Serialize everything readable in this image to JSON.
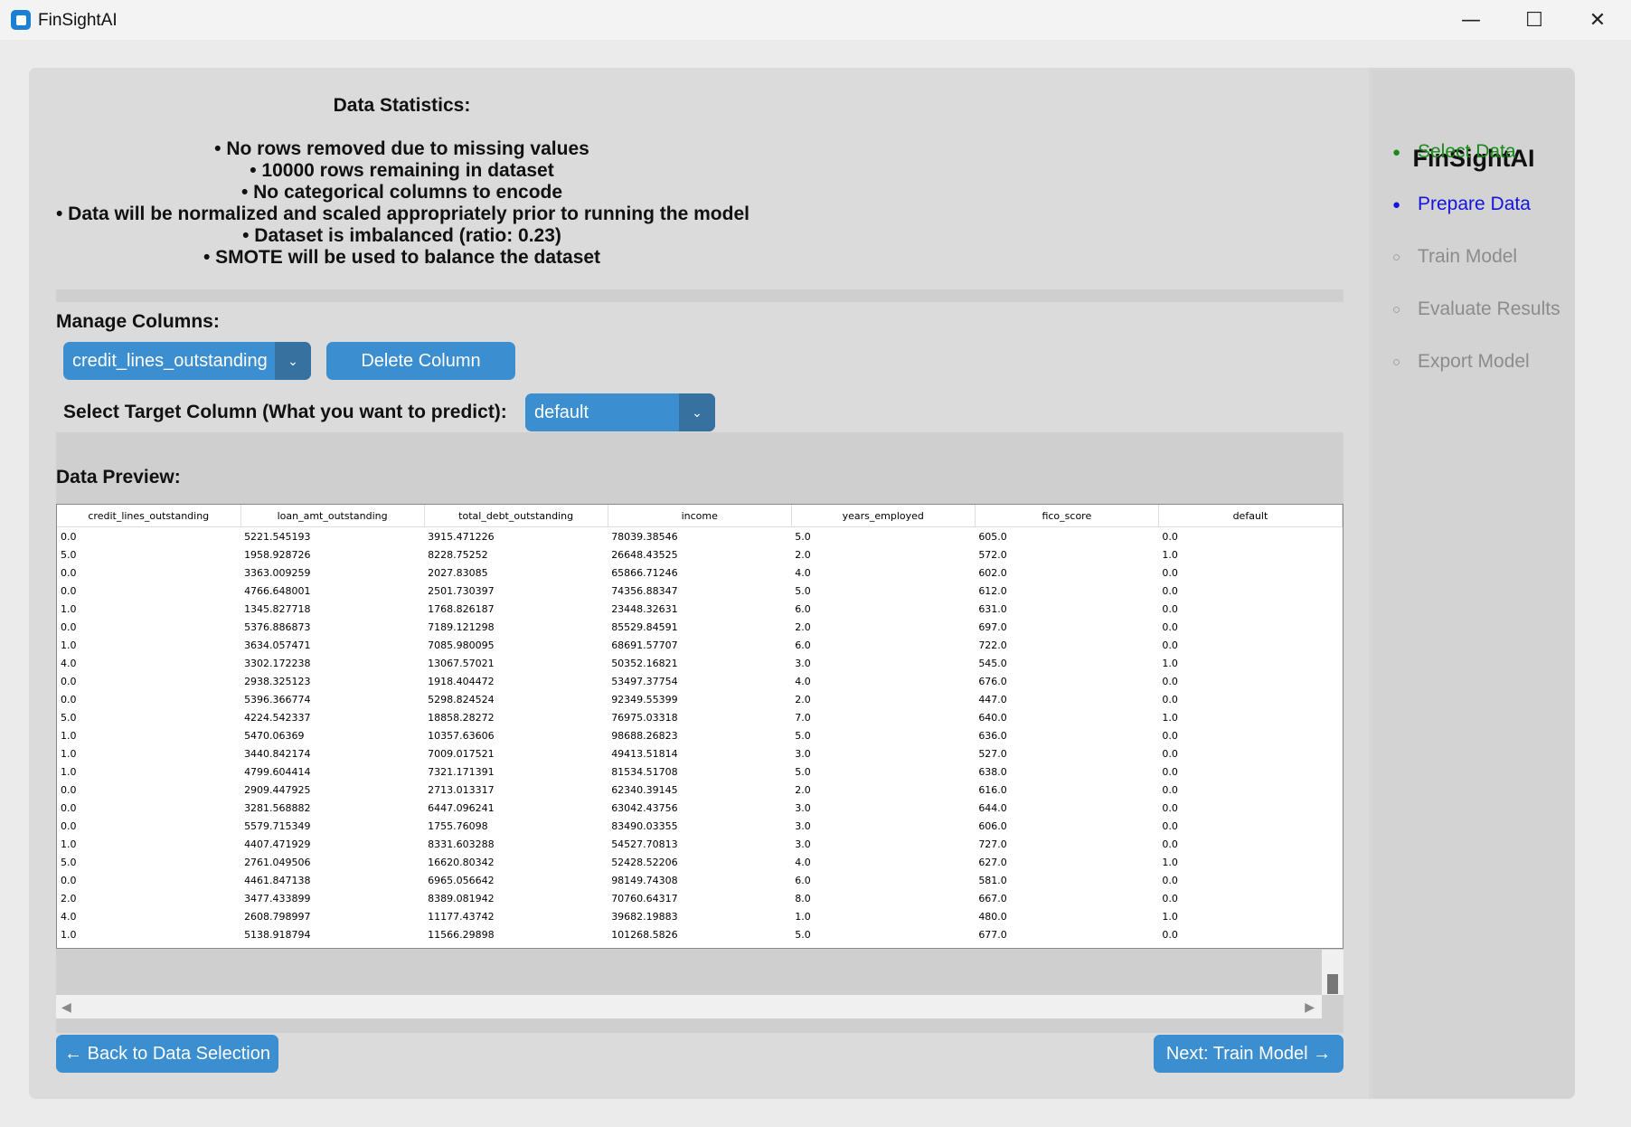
{
  "window": {
    "title": "FinSightAI",
    "minimize": "—",
    "maximize": "☐",
    "close": "✕"
  },
  "stats": {
    "title": "Data Statistics:",
    "lines": [
      "• No rows removed due to missing values",
      "• 10000 rows remaining in dataset",
      "• No categorical columns to encode",
      "• Data will be normalized and scaled appropriately prior to running the model",
      "• Dataset is imbalanced (ratio: 0.23)",
      "• SMOTE will be used to balance the dataset"
    ]
  },
  "manage": {
    "label": "Manage Columns:",
    "selected_column": "credit_lines_outstanding",
    "delete_label": "Delete Column"
  },
  "target": {
    "label": "Select Target Column (What you want to predict):",
    "value": "default"
  },
  "preview": {
    "label": "Data Preview:",
    "columns": [
      "credit_lines_outstanding",
      "loan_amt_outstanding",
      "total_debt_outstanding",
      "income",
      "years_employed",
      "fico_score",
      "default"
    ],
    "rows": [
      [
        "0.0",
        "5221.545193",
        "3915.471226",
        "78039.38546",
        "5.0",
        "605.0",
        "0.0"
      ],
      [
        "5.0",
        "1958.928726",
        "8228.75252",
        "26648.43525",
        "2.0",
        "572.0",
        "1.0"
      ],
      [
        "0.0",
        "3363.009259",
        "2027.83085",
        "65866.71246",
        "4.0",
        "602.0",
        "0.0"
      ],
      [
        "0.0",
        "4766.648001",
        "2501.730397",
        "74356.88347",
        "5.0",
        "612.0",
        "0.0"
      ],
      [
        "1.0",
        "1345.827718",
        "1768.826187",
        "23448.32631",
        "6.0",
        "631.0",
        "0.0"
      ],
      [
        "0.0",
        "5376.886873",
        "7189.121298",
        "85529.84591",
        "2.0",
        "697.0",
        "0.0"
      ],
      [
        "1.0",
        "3634.057471",
        "7085.980095",
        "68691.57707",
        "6.0",
        "722.0",
        "0.0"
      ],
      [
        "4.0",
        "3302.172238",
        "13067.57021",
        "50352.16821",
        "3.0",
        "545.0",
        "1.0"
      ],
      [
        "0.0",
        "2938.325123",
        "1918.404472",
        "53497.37754",
        "4.0",
        "676.0",
        "0.0"
      ],
      [
        "0.0",
        "5396.366774",
        "5298.824524",
        "92349.55399",
        "2.0",
        "447.0",
        "0.0"
      ],
      [
        "5.0",
        "4224.542337",
        "18858.28272",
        "76975.03318",
        "7.0",
        "640.0",
        "1.0"
      ],
      [
        "1.0",
        "5470.06369",
        "10357.63606",
        "98688.26823",
        "5.0",
        "636.0",
        "0.0"
      ],
      [
        "1.0",
        "3440.842174",
        "7009.017521",
        "49413.51814",
        "3.0",
        "527.0",
        "0.0"
      ],
      [
        "1.0",
        "4799.604414",
        "7321.171391",
        "81534.51708",
        "5.0",
        "638.0",
        "0.0"
      ],
      [
        "0.0",
        "2909.447925",
        "2713.013317",
        "62340.39145",
        "2.0",
        "616.0",
        "0.0"
      ],
      [
        "0.0",
        "3281.568882",
        "6447.096241",
        "63042.43756",
        "3.0",
        "644.0",
        "0.0"
      ],
      [
        "0.0",
        "5579.715349",
        "1755.76098",
        "83490.03355",
        "3.0",
        "606.0",
        "0.0"
      ],
      [
        "1.0",
        "4407.471929",
        "8331.603288",
        "54527.70813",
        "3.0",
        "727.0",
        "0.0"
      ],
      [
        "5.0",
        "2761.049506",
        "16620.80342",
        "52428.52206",
        "4.0",
        "627.0",
        "1.0"
      ],
      [
        "0.0",
        "4461.847138",
        "6965.056642",
        "98149.74308",
        "6.0",
        "581.0",
        "0.0"
      ],
      [
        "2.0",
        "3477.433899",
        "8389.081942",
        "70760.64317",
        "8.0",
        "667.0",
        "0.0"
      ],
      [
        "4.0",
        "2608.798997",
        "11177.43742",
        "39682.19883",
        "1.0",
        "480.0",
        "1.0"
      ],
      [
        "1.0",
        "5138.918794",
        "11566.29898",
        "101268.5826",
        "5.0",
        "677.0",
        "0.0"
      ]
    ]
  },
  "nav": {
    "back_label": "← Back to Data Selection",
    "next_label": "Next: Train Model →"
  },
  "sidebar": {
    "title": "FinSightAI",
    "steps": [
      {
        "label": "Select Data",
        "marker": "●",
        "color": "#1a8a1a"
      },
      {
        "label": "Prepare Data",
        "marker": "●",
        "color": "#1414e0"
      },
      {
        "label": "Train Model",
        "marker": "○",
        "color": "#8c8c8c"
      },
      {
        "label": "Evaluate Results",
        "marker": "○",
        "color": "#8c8c8c"
      },
      {
        "label": "Export Model",
        "marker": "○",
        "color": "#8c8c8c"
      }
    ]
  }
}
